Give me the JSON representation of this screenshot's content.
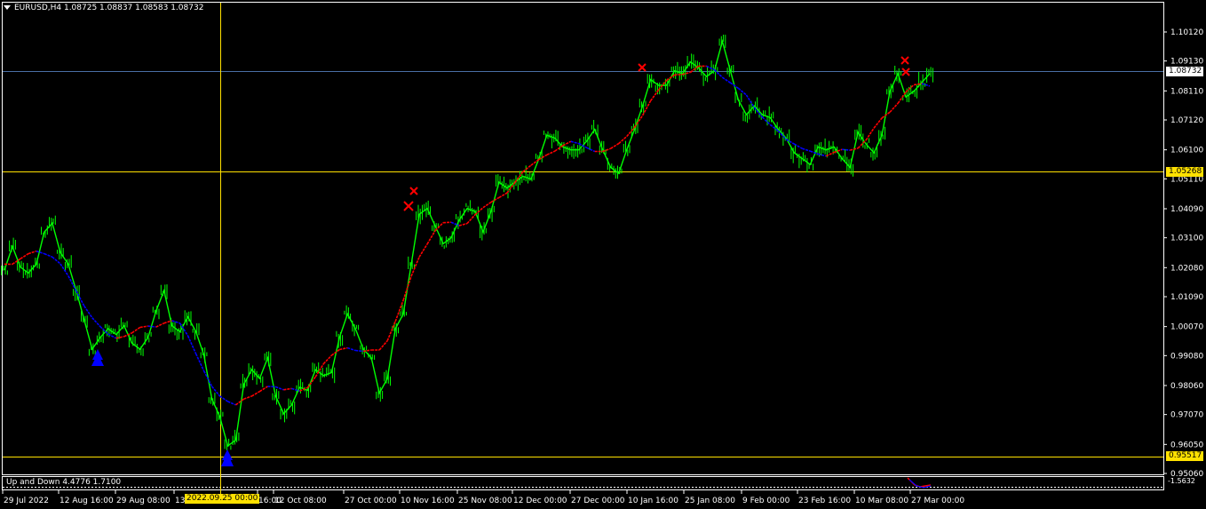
{
  "window": {
    "symbol_title": "EURUSD,H4  1.08725 1.08837 1.08583 1.08732"
  },
  "indicator": {
    "label": "Up and Down 4.4776 1.7100",
    "right_value": "-1.5632"
  },
  "price_axis": {
    "ticks": [
      "1.10120",
      "1.09130",
      "1.08110",
      "1.07120",
      "1.06100",
      "1.05110",
      "1.04090",
      "1.03100",
      "1.02080",
      "1.01090",
      "1.00070",
      "0.99080",
      "0.98060",
      "0.97070",
      "0.96050",
      "0.95060"
    ],
    "current_price": "1.08732",
    "crosshair_price": "1.05268",
    "line_price": "0.95517"
  },
  "time_axis": {
    "labels": [
      "29 Jul 2022",
      "12 Aug 16:00",
      "29 Aug 08:00",
      "13",
      "16:00",
      "12 Oct 08:00",
      "27 Oct 00:00",
      "10 Nov 16:00",
      "25 Nov 08:00",
      "12 Dec 00:00",
      "27 Dec 00:00",
      "10 Jan 16:00",
      "25 Jan 08:00",
      "9 Feb 00:00",
      "23 Feb 16:00",
      "10 Mar 08:00",
      "27 Mar 00:00"
    ],
    "crosshair_time": "2022.09.25 00:00"
  },
  "colors": {
    "background": "#000000",
    "candles": "#00ff00",
    "ma_up": "#ff0000",
    "ma_down": "#0000ff",
    "crosshair": "#ffe100",
    "grid_line": "#4a6fa5",
    "frame": "#ffffff"
  },
  "chart_data": {
    "type": "line",
    "xlabel": "",
    "ylabel": "",
    "ylim": [
      0.949,
      1.104
    ],
    "grid": false,
    "series": [
      {
        "values": [
          1.02,
          1.028,
          1.021,
          1.019,
          1.022,
          1.033,
          1.036,
          1.026,
          1.022,
          1.013,
          1.003,
          0.993,
          0.997,
          1.0,
          0.998,
          1.001,
          0.995,
          0.993,
          0.997,
          1.006,
          1.013,
          1.001,
          0.999,
          1.004,
          0.999,
          0.991,
          0.976,
          0.97,
          0.96,
          0.962,
          0.981,
          0.986,
          0.983,
          0.99,
          0.977,
          0.971,
          0.974,
          0.98,
          0.979,
          0.986,
          0.984,
          0.985,
          0.997,
          1.005,
          1.0,
          0.993,
          0.99,
          0.978,
          0.983,
          1.0,
          1.005,
          1.022,
          1.039,
          1.041,
          1.035,
          1.029,
          1.031,
          1.037,
          1.041,
          1.04,
          1.033,
          1.04,
          1.05,
          1.048,
          1.05,
          1.052,
          1.051,
          1.058,
          1.066,
          1.065,
          1.062,
          1.061,
          1.061,
          1.064,
          1.068,
          1.061,
          1.055,
          1.053,
          1.061,
          1.068,
          1.076,
          1.085,
          1.083,
          1.083,
          1.088,
          1.087,
          1.091,
          1.089,
          1.086,
          1.088,
          1.098,
          1.088,
          1.078,
          1.073,
          1.076,
          1.073,
          1.072,
          1.068,
          1.065,
          1.06,
          1.058,
          1.056,
          1.062,
          1.061,
          1.062,
          1.058,
          1.055,
          1.067,
          1.063,
          1.06,
          1.066,
          1.081,
          1.087,
          1.079,
          1.081,
          1.084,
          1.087
        ]
      }
    ]
  }
}
